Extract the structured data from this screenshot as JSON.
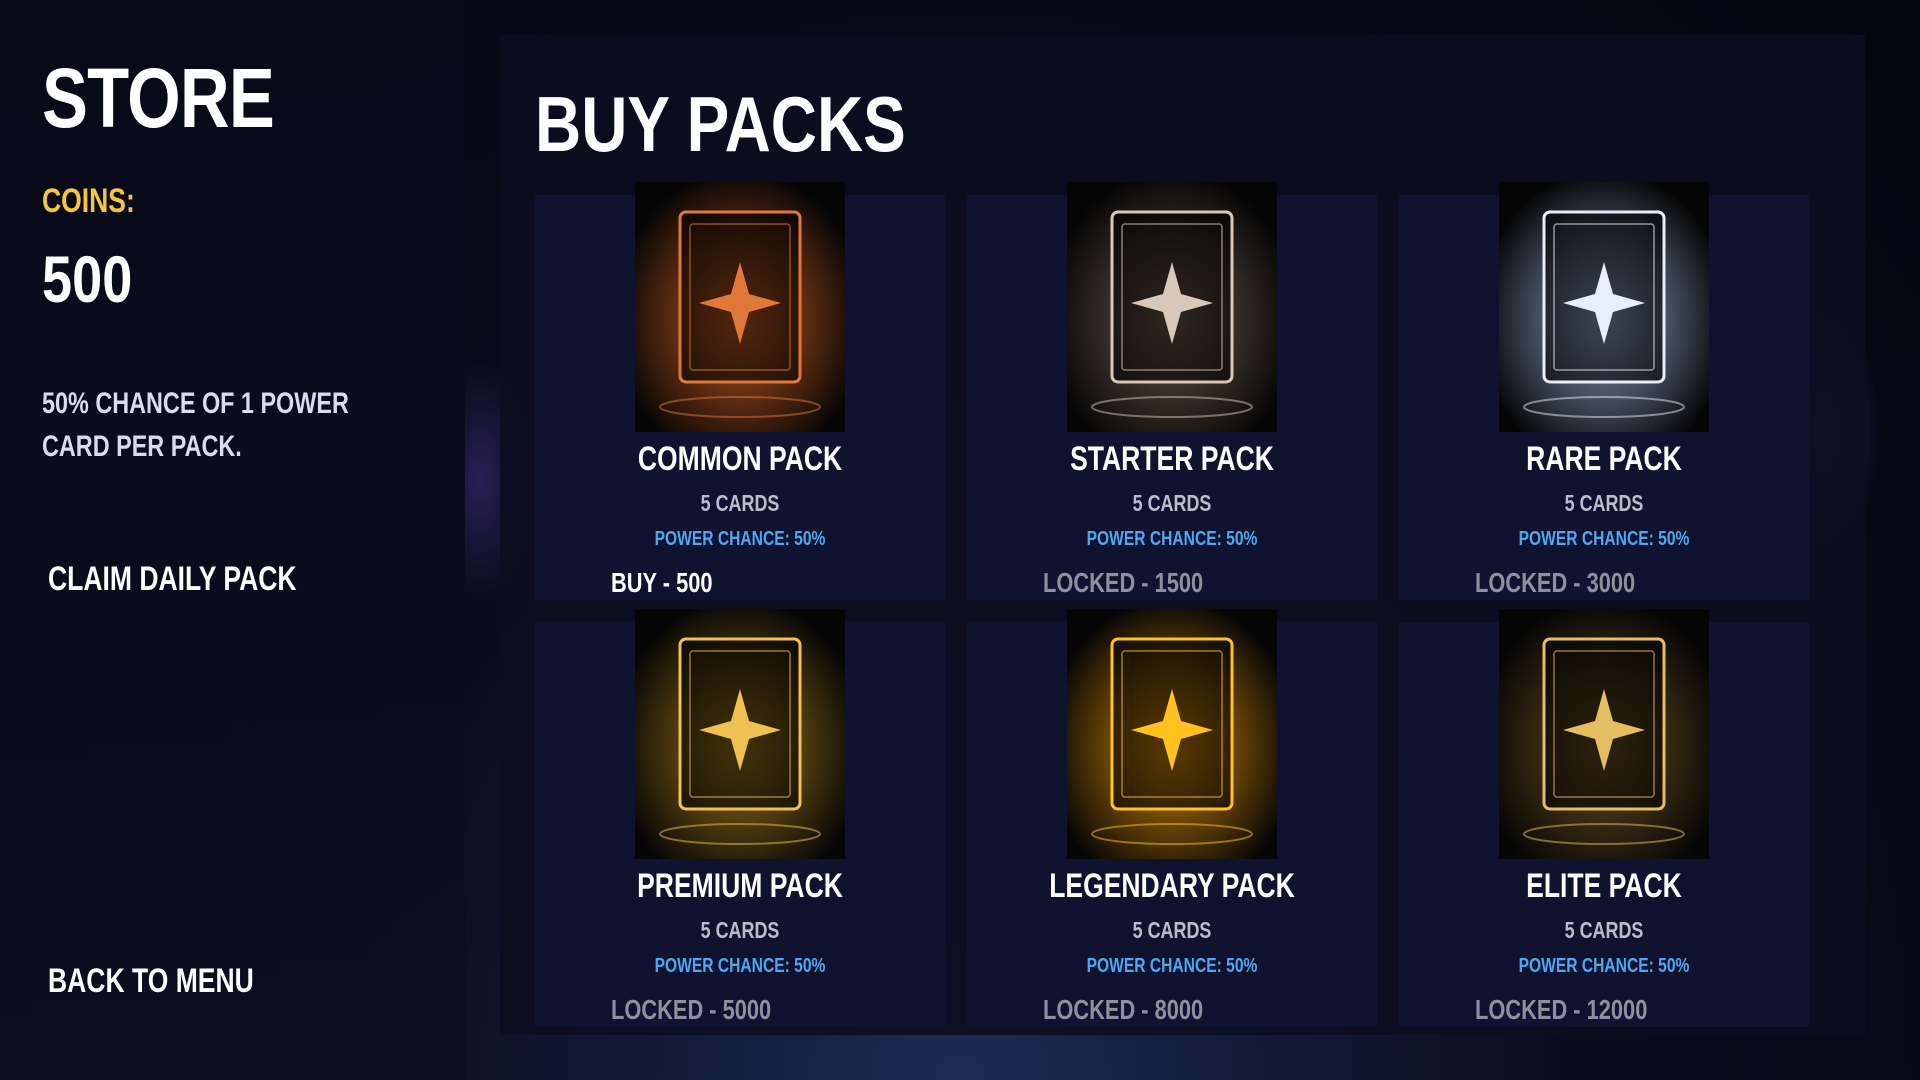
{
  "sidebar": {
    "title": "STORE",
    "coins_label": "COINS:",
    "coins_value": "500",
    "info": "50% CHANCE OF 1 POWER CARD PER PACK.",
    "claim_label": "CLAIM DAILY PACK",
    "back_label": "BACK TO MENU"
  },
  "main": {
    "title": "BUY PACKS",
    "packs": [
      {
        "name": "COMMON PACK",
        "cards": "5 CARDS",
        "chance": "POWER CHANCE: 50%",
        "action": "BUY - 500",
        "accent": "#e0783a",
        "glow": "#c85a20",
        "locked": false
      },
      {
        "name": "STARTER PACK",
        "cards": "5 CARDS",
        "chance": "POWER CHANCE: 50%",
        "action": "LOCKED - 1500",
        "accent": "#d9c8b8",
        "glow": "#6a5a4c",
        "locked": true
      },
      {
        "name": "RARE PACK",
        "cards": "5 CARDS",
        "chance": "POWER CHANCE: 50%",
        "action": "LOCKED - 3000",
        "accent": "#e8eef8",
        "glow": "#8ea6c8",
        "locked": true
      },
      {
        "name": "PREMIUM PACK",
        "cards": "5 CARDS",
        "chance": "POWER CHANCE: 50%",
        "action": "LOCKED - 5000",
        "accent": "#f0c050",
        "glow": "#a07818",
        "locked": true
      },
      {
        "name": "LEGENDARY PACK",
        "cards": "5 CARDS",
        "chance": "POWER CHANCE: 50%",
        "action": "LOCKED - 8000",
        "accent": "#ffc21e",
        "glow": "#d88a08",
        "locked": true
      },
      {
        "name": "ELITE PACK",
        "cards": "5 CARDS",
        "chance": "POWER CHANCE: 50%",
        "action": "LOCKED - 12000",
        "accent": "#e6be62",
        "glow": "#6a5020",
        "locked": true
      }
    ]
  }
}
